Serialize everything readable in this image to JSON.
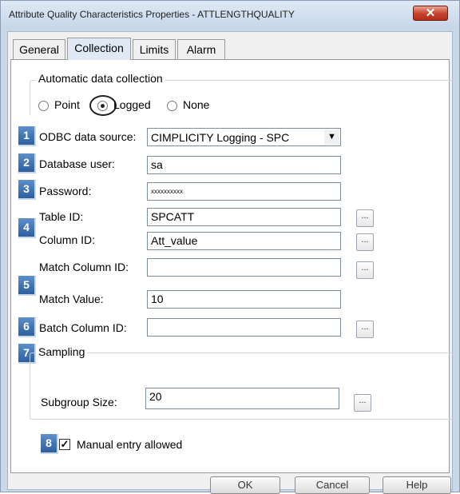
{
  "window": {
    "title": "Attribute Quality Characteristics Properties - ATTLENGTHQUALITY",
    "close_glyph": "✕"
  },
  "tabs": [
    {
      "label": "General"
    },
    {
      "label": "Collection"
    },
    {
      "label": "Limits"
    },
    {
      "label": "Alarm"
    }
  ],
  "collection": {
    "group_title": "Automatic data collection",
    "mode_options": [
      {
        "label": "Point",
        "selected": false
      },
      {
        "label": "Logged",
        "selected": true
      },
      {
        "label": "None",
        "selected": false
      }
    ],
    "odbc_label": "ODBC data source:",
    "odbc_value": "CIMPLICITY Logging - SPC",
    "db_user_label": "Database user:",
    "db_user_value": "sa",
    "password_label": "Password:",
    "password_value": "xxxxxxxxxx",
    "table_id_label": "Table ID:",
    "table_id_value": "SPCATT",
    "column_id_label": "Column ID:",
    "column_id_value": "Att_value",
    "match_column_label": "Match Column ID:",
    "match_column_value": "",
    "match_value_label": "Match Value:",
    "match_value_value": "10",
    "batch_column_label": "Batch Column ID:",
    "batch_column_value": "",
    "browse_label": "...",
    "dropdown_glyph": "▼"
  },
  "sampling": {
    "title": "Sampling",
    "subgroup_label": "Subgroup Size:",
    "subgroup_value": "20"
  },
  "manual_entry": {
    "label": "Manual entry allowed",
    "checked": true,
    "check_glyph": "✓"
  },
  "callouts": [
    "1",
    "2",
    "3",
    "4",
    "5",
    "6",
    "7",
    "8"
  ],
  "buttons": {
    "ok": "OK",
    "cancel": "Cancel",
    "help": "Help"
  }
}
